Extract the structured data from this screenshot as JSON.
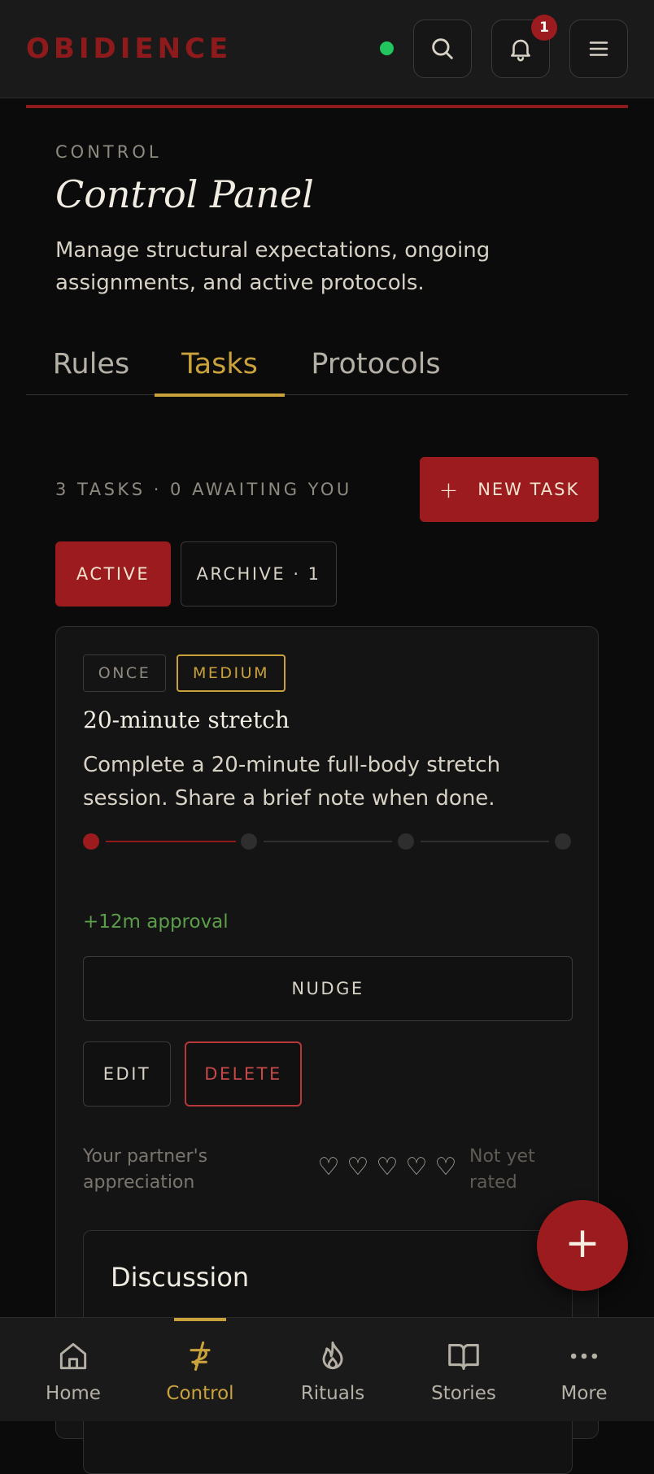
{
  "app": {
    "brand": "OBIDIENCE",
    "notification_count": "1"
  },
  "header": {
    "eyebrow": "CONTROL",
    "title": "Control Panel",
    "description": "Manage structural expectations, ongoing assignments, and active protocols."
  },
  "tabs": [
    {
      "label": "Rules",
      "active": false
    },
    {
      "label": "Tasks",
      "active": true
    },
    {
      "label": "Protocols",
      "active": false
    }
  ],
  "toolbar": {
    "count_label": "3 TASKS · 0 AWAITING YOU",
    "new_task_icon": "+",
    "new_task_label": "NEW TASK"
  },
  "filters": {
    "active": "ACTIVE",
    "archive": "ARCHIVE · 1"
  },
  "task": {
    "frequency": "ONCE",
    "priority": "MEDIUM",
    "title": "20-minute stretch",
    "description": "Complete a 20-minute full-body stretch session. Share a brief note when done.",
    "progress": {
      "steps": 4,
      "completed": 1
    },
    "approval": "+12m approval",
    "nudge_label": "NUDGE",
    "edit_label": "EDIT",
    "delete_label": "DELETE",
    "appreciation_label": "Your partner's appreciation",
    "heart_glyph": "♡",
    "rating_status": "Not yet rated",
    "discussion_title": "Discussion"
  },
  "fab": {
    "label": "+"
  },
  "bottom_nav": [
    {
      "label": "Home",
      "icon": "home-icon",
      "active": false
    },
    {
      "label": "Control",
      "icon": "control-icon",
      "active": true
    },
    {
      "label": "Rituals",
      "icon": "flame-icon",
      "active": false
    },
    {
      "label": "Stories",
      "icon": "book-icon",
      "active": false
    },
    {
      "label": "More",
      "icon": "more-icon",
      "active": false
    }
  ],
  "colors": {
    "accent_red": "#9b1b1e",
    "accent_gold": "#c9a23c",
    "online": "#22c55e",
    "approval_green": "#5c9e4a"
  }
}
